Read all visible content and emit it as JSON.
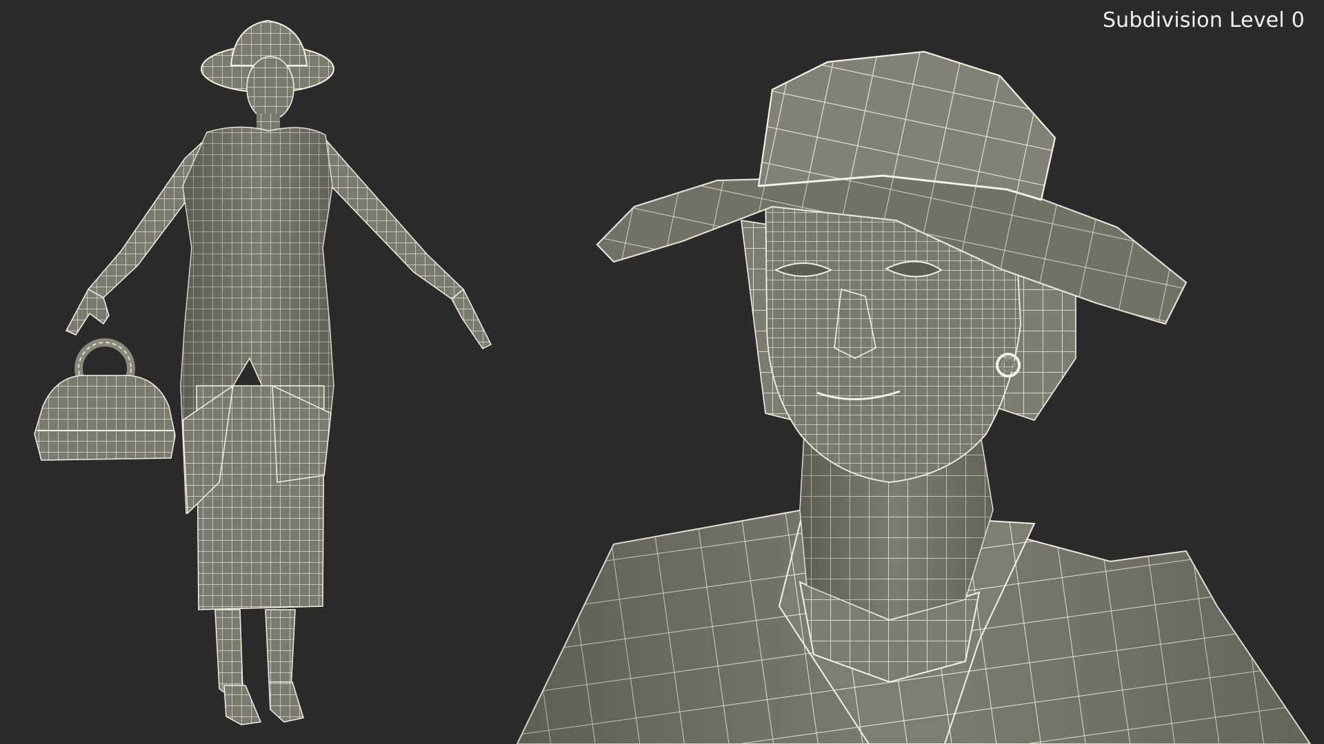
{
  "overlay": {
    "subdivision_label": "Subdivision Level 0"
  },
  "render": {
    "background_color": "#2b2b2b",
    "mesh_fill_color": "#7d7c70",
    "mesh_shadow_color": "#55554c",
    "wire_color": "#f4f2e4"
  },
  "icons": {
    "full_body_view": "wireframe-woman-full-body",
    "handbag": "wireframe-handbag",
    "closeup_view": "wireframe-woman-head-closeup"
  }
}
